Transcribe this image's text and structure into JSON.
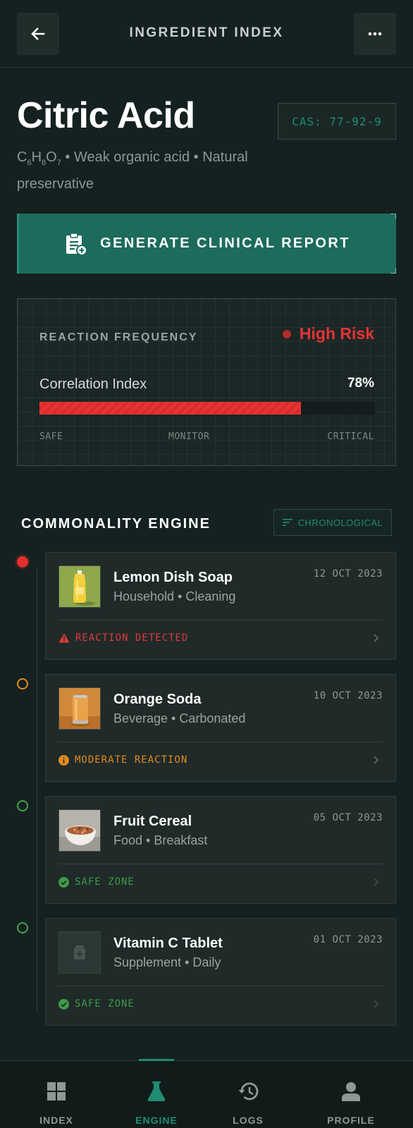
{
  "header": {
    "title": "INGREDIENT INDEX",
    "back_icon": "arrow-left-icon",
    "menu_icon": "more-horizontal-icon"
  },
  "ingredient": {
    "name": "Citric Acid",
    "cas": "CAS: 77-92-9",
    "formula": {
      "c": "C",
      "c_sub": "6",
      "h": "H",
      "h_sub": "8",
      "o": "O",
      "o_sub": "7"
    },
    "description": " • Weak organic acid • Natural preservative"
  },
  "cta": {
    "label": "GENERATE CLINICAL REPORT",
    "icon": "clipboard-plus-icon"
  },
  "reaction": {
    "label": "REACTION FREQUENCY",
    "risk_label": "High Risk",
    "index_label": "Correlation Index",
    "index_value": "78%",
    "index_fraction": 0.78,
    "scale": {
      "low": "SAFE",
      "mid": "MONITOR",
      "high": "CRITICAL"
    }
  },
  "engine": {
    "title": "COMMONALITY ENGINE",
    "sort_label": "CHRONOLOGICAL",
    "items": [
      {
        "name": "Lemon Dish Soap",
        "category": "Household • Cleaning",
        "date": "12 OCT 2023",
        "status": "REACTION DETECTED",
        "status_color": "#e03a3a",
        "status_icon": "warning-triangle-icon",
        "thumb": "dish-soap-bottle"
      },
      {
        "name": "Orange Soda",
        "category": "Beverage • Carbonated",
        "date": "10 OCT 2023",
        "status": "MODERATE REACTION",
        "status_color": "#e38a1f",
        "status_icon": "info-circle-icon",
        "thumb": "soda-can"
      },
      {
        "name": "Fruit Cereal",
        "category": "Food • Breakfast",
        "date": "05 OCT 2023",
        "status": "SAFE ZONE",
        "status_color": "#3f9a47",
        "status_icon": "check-circle-icon",
        "thumb": "cereal-bowl"
      },
      {
        "name": "Vitamin C Tablet",
        "category": "Supplement • Daily",
        "date": "01 OCT 2023",
        "status": "SAFE ZONE",
        "status_color": "#3f9a47",
        "status_icon": "check-circle-icon",
        "thumb": "medicine-bottle-icon"
      }
    ]
  },
  "nav": {
    "items": [
      {
        "label": "INDEX",
        "icon": "grid-icon"
      },
      {
        "label": "ENGINE",
        "icon": "flask-icon"
      },
      {
        "label": "LOGS",
        "icon": "history-icon"
      },
      {
        "label": "PROFILE",
        "icon": "user-icon"
      }
    ],
    "active": "ENGINE"
  },
  "colors": {
    "background": "#142120",
    "accent": "#1c6b5c",
    "accent_text": "#1f8c74",
    "danger": "#e83434",
    "warning": "#e38a1f",
    "safe": "#3f9a47"
  }
}
